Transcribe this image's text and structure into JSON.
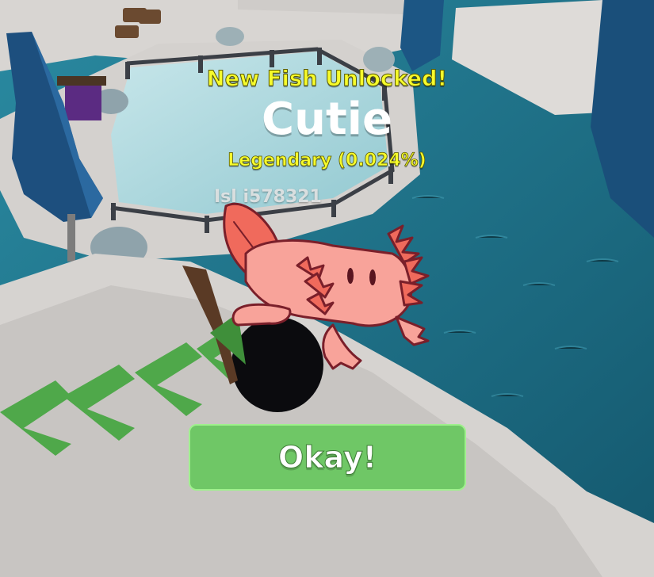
{
  "popup": {
    "title": "New Fish Unlocked!",
    "fish_name": "Cutie",
    "rarity": "Legendary (0.024%)",
    "button_label": "Okay!"
  },
  "world": {
    "player_name": "Isl i578321"
  },
  "fish_icon": "axolotl-icon",
  "colors": {
    "title_yellow": "#f6fb2b",
    "button_green": "#6fc766",
    "axolotl_pink": "#f7968e",
    "water_blue": "#1e6f86"
  }
}
